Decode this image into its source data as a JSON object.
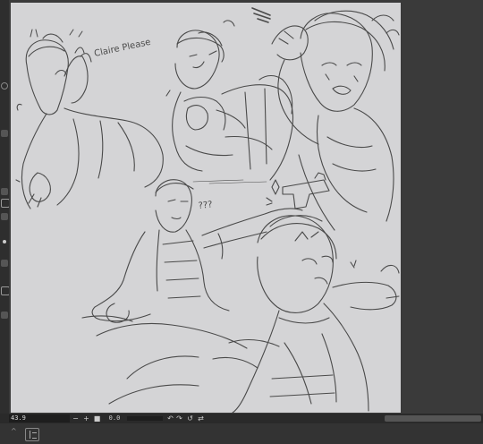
{
  "status_bar": {
    "zoom_value": "43.9",
    "minus_glyph": "−",
    "plus_glyph": "+",
    "stop_glyph": "■",
    "angle_value": "0.0",
    "rotate_left_glyph": "↶",
    "rotate_right_glyph": "↷",
    "reset_glyph": "↺",
    "flip_glyph": "⇄"
  },
  "canvas": {
    "sketch_annotations": {
      "claire_please": "Claire Please",
      "question_marks": "???"
    }
  },
  "icons": [
    "panel-toggle-icon",
    "chevron-up-icon",
    "rotate-left-icon",
    "rotate-right-icon",
    "reset-rotation-icon",
    "flip-icon"
  ],
  "colors": {
    "canvas_bg": "#d4d4d6",
    "ink": "#4a4a4a",
    "ui_dark": "#2e2e2e"
  }
}
